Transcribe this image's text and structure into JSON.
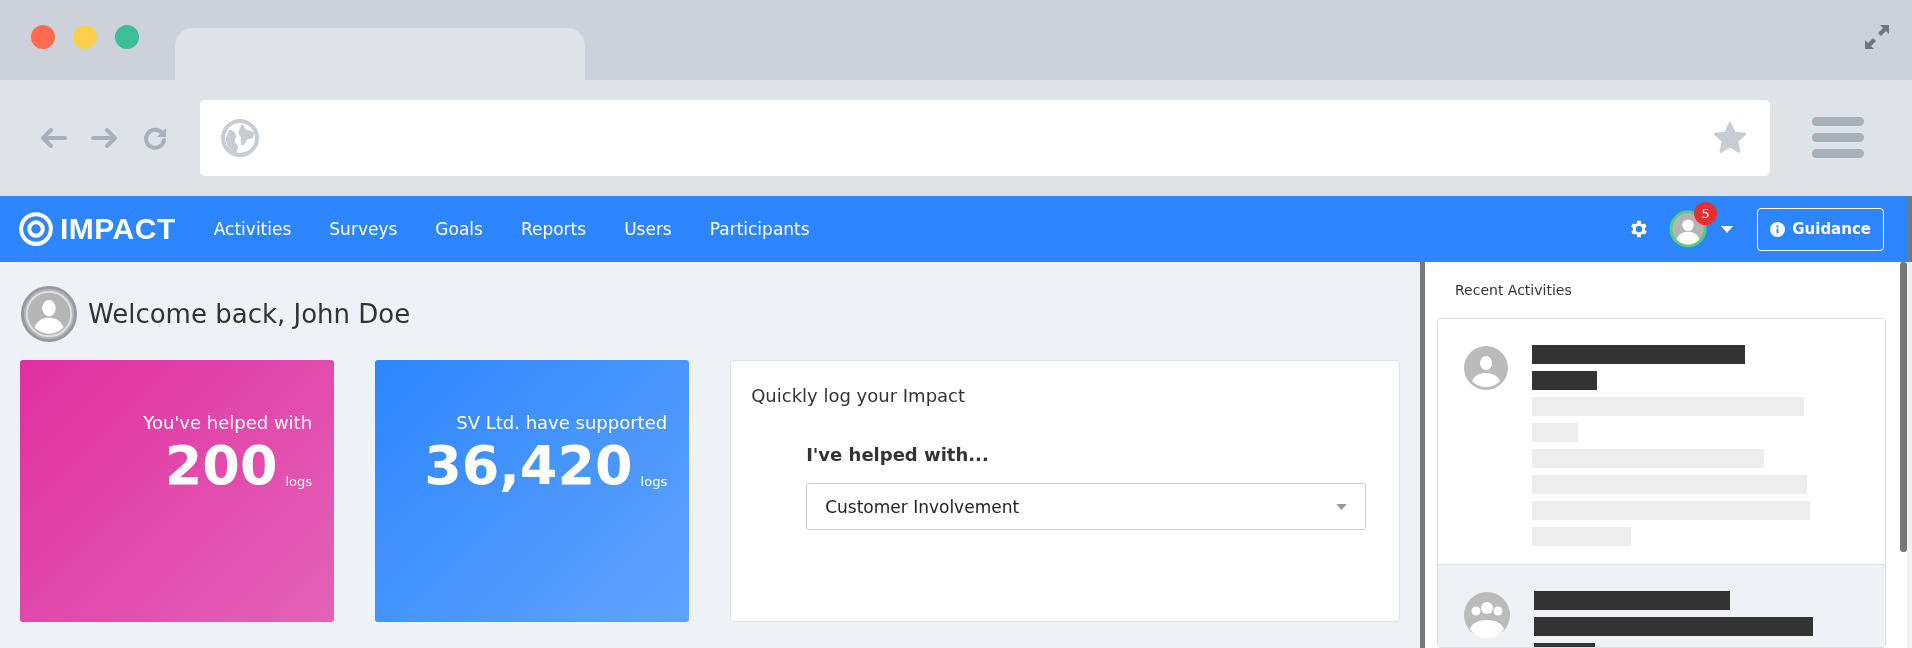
{
  "app": {
    "brand": "IMPACT",
    "nav": [
      {
        "label": "Activities"
      },
      {
        "label": "Surveys"
      },
      {
        "label": "Goals"
      },
      {
        "label": "Reports"
      },
      {
        "label": "Users"
      },
      {
        "label": "Participants"
      }
    ],
    "notifications": "5",
    "guidance_button": "Guidance"
  },
  "welcome": "Welcome back, John Doe",
  "stats": [
    {
      "caption": "You've helped with",
      "value": "200",
      "unit": "logs",
      "color": "#e02fa0"
    },
    {
      "caption": "SV Ltd. have supported",
      "value": "36,420",
      "unit": "logs",
      "color": "#2d86ff"
    }
  ],
  "quick_log": {
    "title": "Quickly log your Impact",
    "prompt": "I've helped with...",
    "select_value": "Customer Involvement"
  },
  "recent_activities": {
    "title": "Recent Activities",
    "items": [
      {
        "kind": "person",
        "selected": false
      },
      {
        "kind": "group",
        "selected": true
      }
    ]
  }
}
